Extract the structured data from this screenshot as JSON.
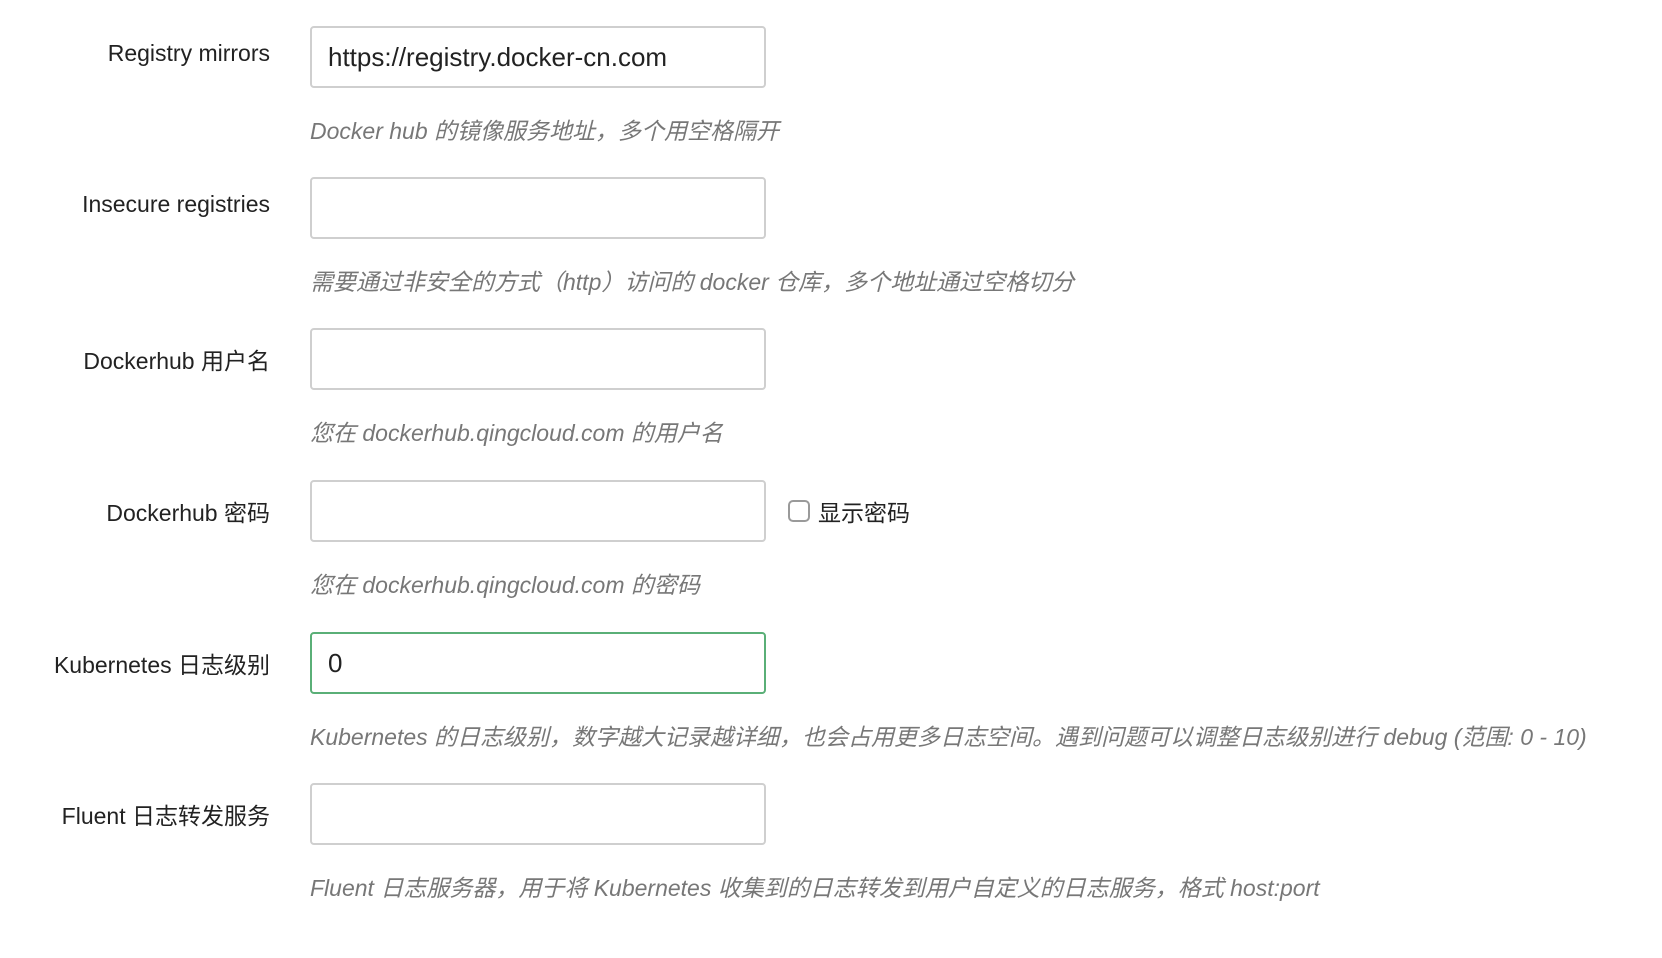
{
  "fields": [
    {
      "label": "Registry mirrors",
      "value": "https://registry.docker-cn.com",
      "help": "Docker hub 的镜像服务地址，多个用空格隔开"
    },
    {
      "label": "Insecure registries",
      "value": "",
      "help": "需要通过非安全的方式（http）访问的 docker 仓库，多个地址通过空格切分"
    },
    {
      "label": "Dockerhub 用户名",
      "value": "",
      "help": "您在 dockerhub.qingcloud.com 的用户名"
    },
    {
      "label": "Dockerhub 密码",
      "value": "",
      "help": "您在 dockerhub.qingcloud.com 的密码",
      "show_password_label": "显示密码",
      "show_password_checked": false
    },
    {
      "label": "Kubernetes 日志级别",
      "value": "0",
      "help": "Kubernetes 的日志级别，数字越大记录越详细，也会占用更多日志空间。遇到问题可以调整日志级别进行 debug (范围: 0 - 10)",
      "focused": true,
      "focus_color": "#5aaf77"
    },
    {
      "label": "Fluent 日志转发服务",
      "value": "",
      "help": "Fluent 日志服务器，用于将 Kubernetes 收集到的日志转发到用户自定义的日志服务，格式 host:port"
    }
  ]
}
